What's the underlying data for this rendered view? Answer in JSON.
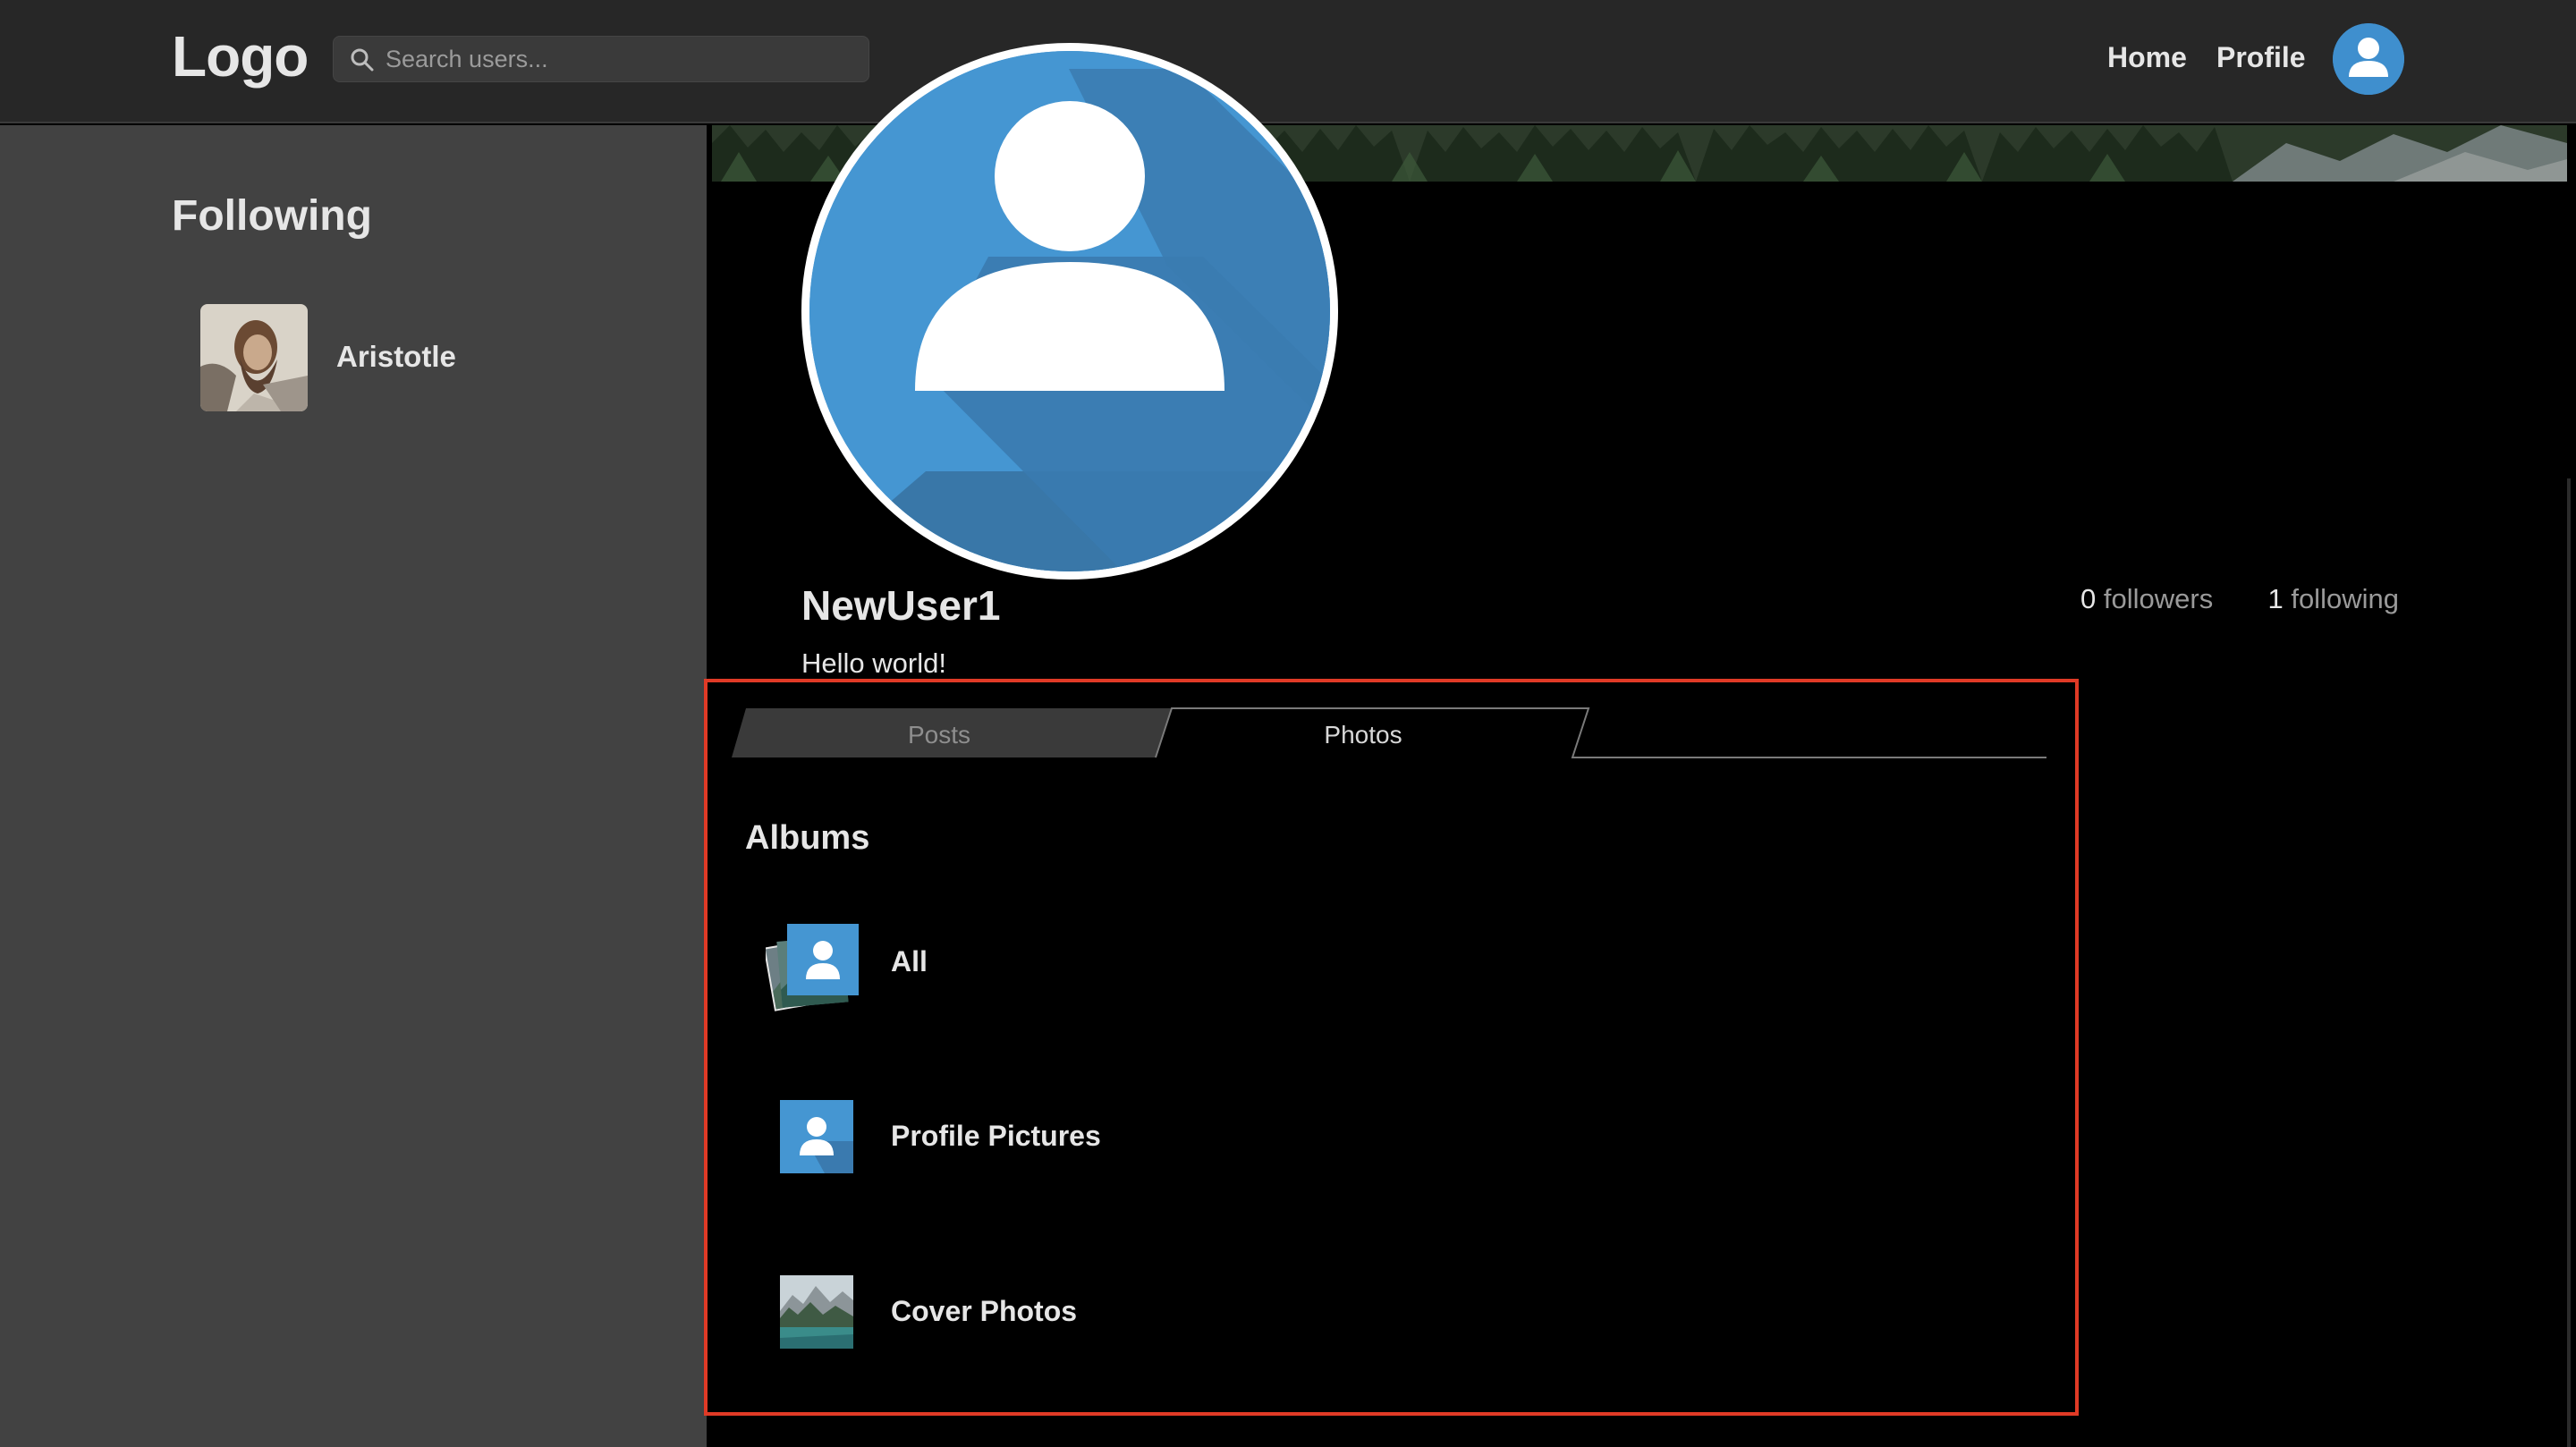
{
  "header": {
    "logo": "Logo",
    "search_placeholder": "Search users...",
    "nav": {
      "home": "Home",
      "profile": "Profile"
    }
  },
  "sidebar": {
    "title": "Following",
    "items": [
      {
        "name": "Aristotle"
      }
    ]
  },
  "profile": {
    "username": "NewUser1",
    "bio": "Hello world!",
    "followers_count": "0",
    "followers_label": "followers",
    "following_count": "1",
    "following_label": "following"
  },
  "tabs": [
    {
      "label": "Posts",
      "active": false
    },
    {
      "label": "Photos",
      "active": true
    }
  ],
  "albums": {
    "title": "Albums",
    "items": [
      {
        "label": "All",
        "icon": "stacked-photos-icon"
      },
      {
        "label": "Profile Pictures",
        "icon": "user-avatar-icon"
      },
      {
        "label": "Cover Photos",
        "icon": "landscape-photo-icon"
      }
    ]
  },
  "colors": {
    "accent_blue": "#3f8fce",
    "highlight": "#e03a26",
    "sidebar_bg": "#424242",
    "topbar_bg": "#272727"
  }
}
